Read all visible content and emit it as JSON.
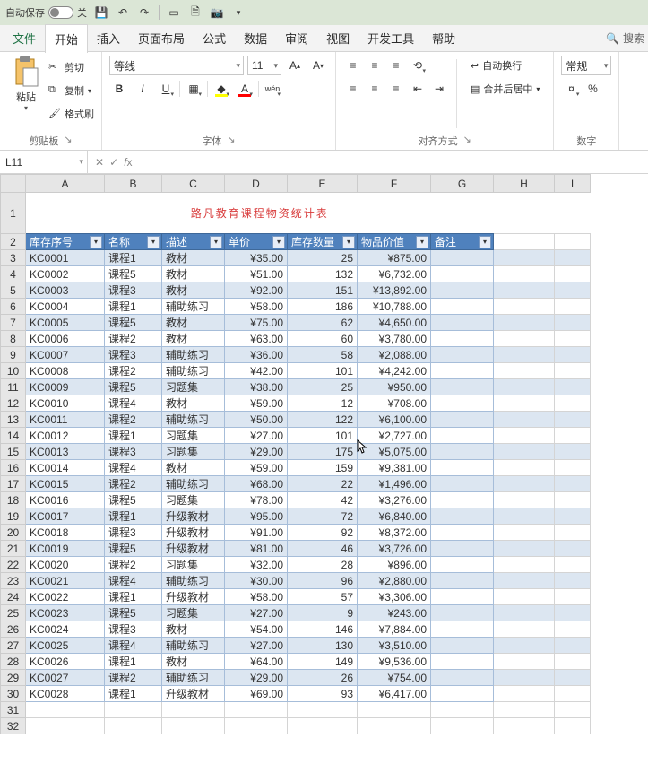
{
  "qat": {
    "autosave_label": "自动保存",
    "autosave_state": "关"
  },
  "menu": {
    "file": "文件",
    "home": "开始",
    "insert": "插入",
    "layout": "页面布局",
    "formula": "公式",
    "data": "数据",
    "review": "审阅",
    "view": "视图",
    "dev": "开发工具",
    "help": "帮助",
    "search": "搜索"
  },
  "ribbon": {
    "clipboard": {
      "paste": "粘贴",
      "cut": "剪切",
      "copy": "复制",
      "fmtpaint": "格式刷",
      "group": "剪贴板"
    },
    "font": {
      "name": "等线",
      "size": "11",
      "group": "字体"
    },
    "align": {
      "wrap": "自动换行",
      "merge": "合并后居中",
      "group": "对齐方式"
    },
    "number": {
      "general": "常规",
      "group": "数字"
    }
  },
  "namebox": "L11",
  "cols": [
    "A",
    "B",
    "C",
    "D",
    "E",
    "F",
    "G",
    "H",
    "I"
  ],
  "doc_title": "路凡教育课程物资统计表",
  "headers": [
    "库存序号",
    "名称",
    "描述",
    "单价",
    "库存数量",
    "物品价值",
    "备注"
  ],
  "rows": [
    {
      "n": 3,
      "a": "KC0001",
      "b": "课程1",
      "c": "教材",
      "d": "¥35.00",
      "e": "25",
      "f": "¥875.00"
    },
    {
      "n": 4,
      "a": "KC0002",
      "b": "课程5",
      "c": "教材",
      "d": "¥51.00",
      "e": "132",
      "f": "¥6,732.00"
    },
    {
      "n": 5,
      "a": "KC0003",
      "b": "课程3",
      "c": "教材",
      "d": "¥92.00",
      "e": "151",
      "f": "¥13,892.00"
    },
    {
      "n": 6,
      "a": "KC0004",
      "b": "课程1",
      "c": "辅助练习",
      "d": "¥58.00",
      "e": "186",
      "f": "¥10,788.00"
    },
    {
      "n": 7,
      "a": "KC0005",
      "b": "课程5",
      "c": "教材",
      "d": "¥75.00",
      "e": "62",
      "f": "¥4,650.00"
    },
    {
      "n": 8,
      "a": "KC0006",
      "b": "课程2",
      "c": "教材",
      "d": "¥63.00",
      "e": "60",
      "f": "¥3,780.00"
    },
    {
      "n": 9,
      "a": "KC0007",
      "b": "课程3",
      "c": "辅助练习",
      "d": "¥36.00",
      "e": "58",
      "f": "¥2,088.00"
    },
    {
      "n": 10,
      "a": "KC0008",
      "b": "课程2",
      "c": "辅助练习",
      "d": "¥42.00",
      "e": "101",
      "f": "¥4,242.00"
    },
    {
      "n": 11,
      "a": "KC0009",
      "b": "课程5",
      "c": "习题集",
      "d": "¥38.00",
      "e": "25",
      "f": "¥950.00"
    },
    {
      "n": 12,
      "a": "KC0010",
      "b": "课程4",
      "c": "教材",
      "d": "¥59.00",
      "e": "12",
      "f": "¥708.00"
    },
    {
      "n": 13,
      "a": "KC0011",
      "b": "课程2",
      "c": "辅助练习",
      "d": "¥50.00",
      "e": "122",
      "f": "¥6,100.00"
    },
    {
      "n": 14,
      "a": "KC0012",
      "b": "课程1",
      "c": "习题集",
      "d": "¥27.00",
      "e": "101",
      "f": "¥2,727.00"
    },
    {
      "n": 15,
      "a": "KC0013",
      "b": "课程3",
      "c": "习题集",
      "d": "¥29.00",
      "e": "175",
      "f": "¥5,075.00"
    },
    {
      "n": 16,
      "a": "KC0014",
      "b": "课程4",
      "c": "教材",
      "d": "¥59.00",
      "e": "159",
      "f": "¥9,381.00"
    },
    {
      "n": 17,
      "a": "KC0015",
      "b": "课程2",
      "c": "辅助练习",
      "d": "¥68.00",
      "e": "22",
      "f": "¥1,496.00"
    },
    {
      "n": 18,
      "a": "KC0016",
      "b": "课程5",
      "c": "习题集",
      "d": "¥78.00",
      "e": "42",
      "f": "¥3,276.00"
    },
    {
      "n": 19,
      "a": "KC0017",
      "b": "课程1",
      "c": "升级教材",
      "d": "¥95.00",
      "e": "72",
      "f": "¥6,840.00"
    },
    {
      "n": 20,
      "a": "KC0018",
      "b": "课程3",
      "c": "升级教材",
      "d": "¥91.00",
      "e": "92",
      "f": "¥8,372.00"
    },
    {
      "n": 21,
      "a": "KC0019",
      "b": "课程5",
      "c": "升级教材",
      "d": "¥81.00",
      "e": "46",
      "f": "¥3,726.00"
    },
    {
      "n": 22,
      "a": "KC0020",
      "b": "课程2",
      "c": "习题集",
      "d": "¥32.00",
      "e": "28",
      "f": "¥896.00"
    },
    {
      "n": 23,
      "a": "KC0021",
      "b": "课程4",
      "c": "辅助练习",
      "d": "¥30.00",
      "e": "96",
      "f": "¥2,880.00"
    },
    {
      "n": 24,
      "a": "KC0022",
      "b": "课程1",
      "c": "升级教材",
      "d": "¥58.00",
      "e": "57",
      "f": "¥3,306.00"
    },
    {
      "n": 25,
      "a": "KC0023",
      "b": "课程5",
      "c": "习题集",
      "d": "¥27.00",
      "e": "9",
      "f": "¥243.00"
    },
    {
      "n": 26,
      "a": "KC0024",
      "b": "课程3",
      "c": "教材",
      "d": "¥54.00",
      "e": "146",
      "f": "¥7,884.00"
    },
    {
      "n": 27,
      "a": "KC0025",
      "b": "课程4",
      "c": "辅助练习",
      "d": "¥27.00",
      "e": "130",
      "f": "¥3,510.00"
    },
    {
      "n": 28,
      "a": "KC0026",
      "b": "课程1",
      "c": "教材",
      "d": "¥64.00",
      "e": "149",
      "f": "¥9,536.00"
    },
    {
      "n": 29,
      "a": "KC0027",
      "b": "课程2",
      "c": "辅助练习",
      "d": "¥29.00",
      "e": "26",
      "f": "¥754.00"
    },
    {
      "n": 30,
      "a": "KC0028",
      "b": "课程1",
      "c": "升级教材",
      "d": "¥69.00",
      "e": "93",
      "f": "¥6,417.00"
    }
  ]
}
